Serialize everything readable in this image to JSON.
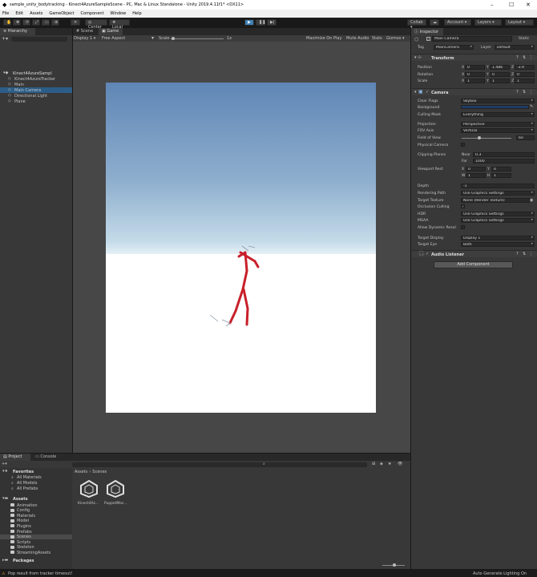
{
  "window": {
    "title": "sample_unity_bodytracking - Kinect4AzureSampleScene - PC, Mac & Linux Standalone - Unity 2019.4.11f1* <DX11>"
  },
  "menu": [
    "File",
    "Edit",
    "Assets",
    "GameObject",
    "Component",
    "Window",
    "Help"
  ],
  "toolbar": {
    "center_label": "Center",
    "local_label": "Local",
    "collab_label": "Collab",
    "account_label": "Account",
    "layers_label": "Layers",
    "layout_label": "Layout"
  },
  "hierarchy": {
    "tab": "Hierarchy",
    "items": [
      {
        "label": "Kinect4AzureSampl",
        "depth": 0,
        "selected": false
      },
      {
        "label": "Kinect4AzureTracker",
        "depth": 1,
        "selected": false
      },
      {
        "label": "Main",
        "depth": 1,
        "selected": false
      },
      {
        "label": "Main Camera",
        "depth": 1,
        "selected": true
      },
      {
        "label": "Directional Light",
        "depth": 1,
        "selected": false
      },
      {
        "label": "Plane",
        "depth": 1,
        "selected": false
      }
    ]
  },
  "game_view": {
    "tabs": [
      "Scene",
      "Game"
    ],
    "display": "Display 1",
    "aspect": "Free Aspect",
    "scale_label": "Scale",
    "scale_value": "1x",
    "options": [
      "Maximize On Play",
      "Mute Audio",
      "Stats",
      "Gizmos"
    ]
  },
  "inspector": {
    "tab": "Inspector",
    "object_name": "Main Camera",
    "static_label": "Static",
    "tag_label": "Tag",
    "tag_value": "MainCamera",
    "layer_label": "Layer",
    "layer_value": "Default",
    "transform": {
      "title": "Transform",
      "position_label": "Position",
      "rotation_label": "Rotation",
      "scale_label": "Scale",
      "position": {
        "x": "0",
        "y": "1.486",
        "z": "-3.9"
      },
      "rotation": {
        "x": "0",
        "y": "0",
        "z": "0"
      },
      "scale": {
        "x": "1",
        "y": "1",
        "z": "1"
      }
    },
    "camera": {
      "title": "Camera",
      "clear_flags_label": "Clear Flags",
      "clear_flags": "Skybox",
      "background_label": "Background",
      "background_color": "#1f3b63",
      "culling_mask_label": "Culling Mask",
      "culling_mask": "Everything",
      "projection_label": "Projection",
      "projection": "Perspective",
      "fov_axis_label": "FOV Axis",
      "fov_axis": "Vertical",
      "fov_label": "Field of View",
      "fov": "60",
      "physical_camera_label": "Physical Camera",
      "clipping_label": "Clipping Planes",
      "near_label": "Near",
      "near": "0.3",
      "far_label": "Far",
      "far": "1000",
      "viewport_label": "Viewport Rect",
      "vp_x": "0",
      "vp_y": "0",
      "vp_w": "1",
      "vp_h": "1",
      "depth_label": "Depth",
      "depth": "-1",
      "rendering_path_label": "Rendering Path",
      "rendering_path": "Use Graphics Settings",
      "target_texture_label": "Target Texture",
      "target_texture": "None (Render Texture)",
      "occlusion_label": "Occlusion Culling",
      "hdr_label": "HDR",
      "hdr": "Use Graphics Settings",
      "msaa_label": "MSAA",
      "msaa": "Use Graphics Settings",
      "dynamic_res_label": "Allow Dynamic Resol",
      "target_display_label": "Target Display",
      "target_display": "Display 1",
      "target_eye_label": "Target Eye",
      "target_eye": "Both"
    },
    "audio_listener": {
      "title": "Audio Listener"
    },
    "add_component": "Add Component"
  },
  "project": {
    "tabs": [
      "Project",
      "Console"
    ],
    "favorites_title": "Favorites",
    "favorites": [
      "All Materials",
      "All Models",
      "All Prefabs"
    ],
    "assets_title": "Assets",
    "folders": [
      "Animation",
      "Config",
      "Materials",
      "Model",
      "Plugins",
      "Prefabs",
      "Scenes",
      "Scripts",
      "Skeleton",
      "StreamingAssets"
    ],
    "packages_title": "Packages",
    "breadcrumb_root": "Assets",
    "breadcrumb_current": "Scenes",
    "files": [
      "Kinect4Az...",
      "PuppetMas..."
    ]
  },
  "status": {
    "message": "Pop result from tracker timeout!",
    "right": "Auto Generate Lighting On"
  },
  "colors": {
    "selection": "#2c5d87",
    "play_active": "#3f7fb5",
    "skeleton": "#c8202a"
  }
}
